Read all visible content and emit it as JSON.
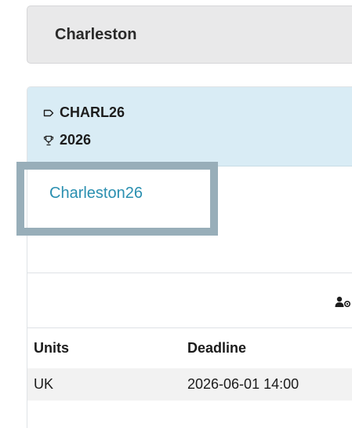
{
  "header": {
    "title": "Charleston"
  },
  "info": {
    "code": "CHARL26",
    "year": "2026"
  },
  "link": {
    "text": "Charleston26"
  },
  "table": {
    "headers": [
      "Units",
      "Deadline"
    ],
    "rows": [
      [
        "UK",
        "2026-06-01 14:00"
      ]
    ]
  },
  "icons": {
    "tag": "tag-icon",
    "trophy": "trophy-icon",
    "action": "user-settings-icon"
  },
  "colors": {
    "link": "#2a8fb0",
    "info_bg": "#d9ecf5",
    "header_bg": "#e9e9ea",
    "highlight": "#98aeb9"
  }
}
